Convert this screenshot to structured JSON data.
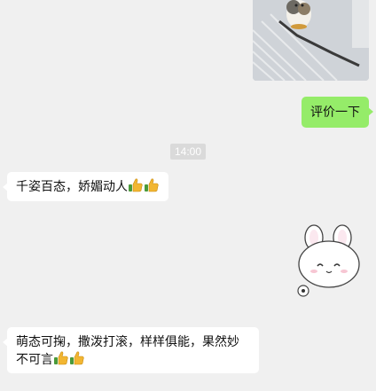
{
  "chat": {
    "messages": [
      {
        "sender": "self",
        "type": "image",
        "icon": "cat-photo"
      },
      {
        "sender": "self",
        "type": "text",
        "text": "评价一下"
      },
      {
        "type": "timestamp",
        "text": "14:00"
      },
      {
        "sender": "other",
        "type": "text",
        "text": "千姿百态，娇媚动人",
        "emoji": [
          "thumbs-up-icon",
          "thumbs-up-icon"
        ]
      },
      {
        "sender": "self",
        "type": "sticker",
        "icon": "white-bunny-sticker"
      },
      {
        "sender": "other",
        "type": "text",
        "text": "萌态可掬，撒泼打滚，样样俱能，果然妙不可言",
        "emoji": [
          "thumbs-up-icon",
          "thumbs-up-icon"
        ]
      }
    ]
  },
  "colors": {
    "background": "#f0f0f0",
    "self_bubble": "#95ec69",
    "other_bubble": "#ffffff",
    "timestamp_bg": "#dadada"
  }
}
